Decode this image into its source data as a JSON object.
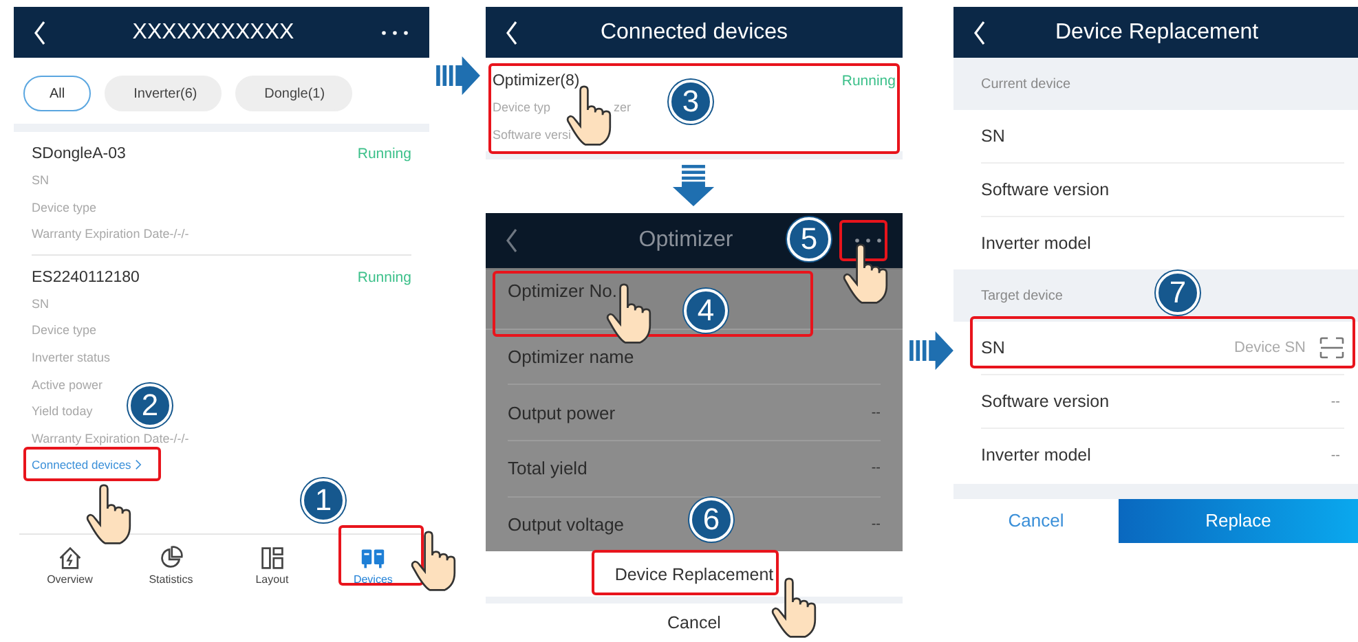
{
  "device_list": {
    "title": "XXXXXXXXXXX",
    "filters": [
      {
        "label": "All",
        "selected": true
      },
      {
        "label": "Inverter(6)",
        "selected": false
      },
      {
        "label": "Dongle(1)",
        "selected": false
      }
    ],
    "devices": [
      {
        "name": "SDongleA-03",
        "status": "Running",
        "fields": [
          "SN",
          "Device type",
          "Warranty Expiration Date-/-/-"
        ]
      },
      {
        "name": "ES2240112180",
        "status": "Running",
        "fields": [
          "SN",
          "Device type",
          "Inverter status",
          "Active power",
          "Yield today",
          "Warranty Expiration Date-/-/-"
        ],
        "link": "Connected devices"
      }
    ],
    "nav": [
      {
        "label": "Overview",
        "selected": false
      },
      {
        "label": "Statistics",
        "selected": false
      },
      {
        "label": "Layout",
        "selected": false
      },
      {
        "label": "Devices",
        "selected": true
      }
    ]
  },
  "connected_devices": {
    "title": "Connected devices",
    "device": {
      "name": "Optimizer(8)",
      "status": "Running",
      "fields": [
        {
          "label": "Device typ",
          "value": "zer"
        },
        {
          "label": "Software versi"
        }
      ]
    }
  },
  "optimizer": {
    "title": "Optimizer",
    "rows": [
      {
        "label": "Optimizer No."
      },
      {
        "label": "Optimizer name"
      },
      {
        "label": "Output power",
        "value": "--"
      },
      {
        "label": "Total yield",
        "value": "--"
      },
      {
        "label": "Output voltage",
        "value": "--"
      }
    ],
    "sheet": [
      "Device Replacement",
      "Cancel"
    ]
  },
  "replacement": {
    "title": "Device Replacement",
    "sections": [
      {
        "header": "Current device",
        "rows": [
          {
            "label": "SN"
          },
          {
            "label": "Software version"
          },
          {
            "label": "Inverter model"
          }
        ]
      },
      {
        "header": "Target device",
        "rows": [
          {
            "label": "SN",
            "placeholder": "Device SN"
          },
          {
            "label": "Software version",
            "value": "--"
          },
          {
            "label": "Inverter model",
            "value": "--"
          }
        ]
      }
    ],
    "buttons": [
      {
        "label": "Cancel",
        "kind": "secondary"
      },
      {
        "label": "Replace",
        "kind": "primary"
      }
    ]
  },
  "steps": [
    "1",
    "2",
    "3",
    "4",
    "5",
    "6",
    "7"
  ]
}
